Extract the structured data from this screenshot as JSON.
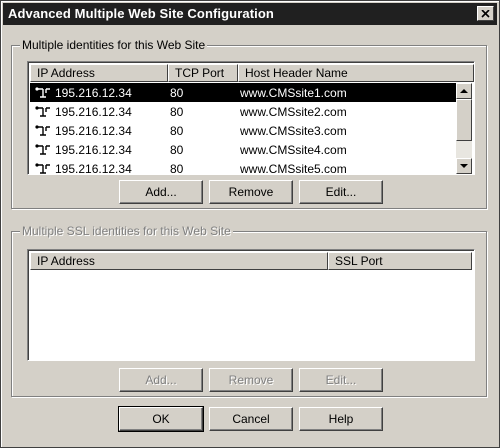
{
  "window": {
    "title": "Advanced Multiple Web Site Configuration",
    "close_glyph": "✕"
  },
  "identities": {
    "legend": "Multiple identities for this Web Site",
    "columns": [
      "IP Address",
      "TCP Port",
      "Host Header Name"
    ],
    "rows": [
      {
        "ip": "195.216.12.34",
        "port": "80",
        "host": "www.CMSsite1.com",
        "selected": true
      },
      {
        "ip": "195.216.12.34",
        "port": "80",
        "host": "www.CMSsite2.com"
      },
      {
        "ip": "195.216.12.34",
        "port": "80",
        "host": "www.CMSsite3.com"
      },
      {
        "ip": "195.216.12.34",
        "port": "80",
        "host": "www.CMSsite4.com"
      },
      {
        "ip": "195.216.12.34",
        "port": "80",
        "host": "www.CMSsite5.com"
      }
    ],
    "buttons": {
      "add": "Add...",
      "remove": "Remove",
      "edit": "Edit..."
    }
  },
  "ssl": {
    "legend": "Multiple SSL identities for this Web Site",
    "columns": [
      "IP Address",
      "SSL Port"
    ],
    "buttons": {
      "add": "Add...",
      "remove": "Remove",
      "edit": "Edit..."
    }
  },
  "footer": {
    "ok": "OK",
    "cancel": "Cancel",
    "help": "Help"
  },
  "icons": {
    "row_icon": "network-connector-icon",
    "close": "close-icon",
    "scroll_up": "arrow-up-icon",
    "scroll_down": "arrow-down-icon"
  }
}
